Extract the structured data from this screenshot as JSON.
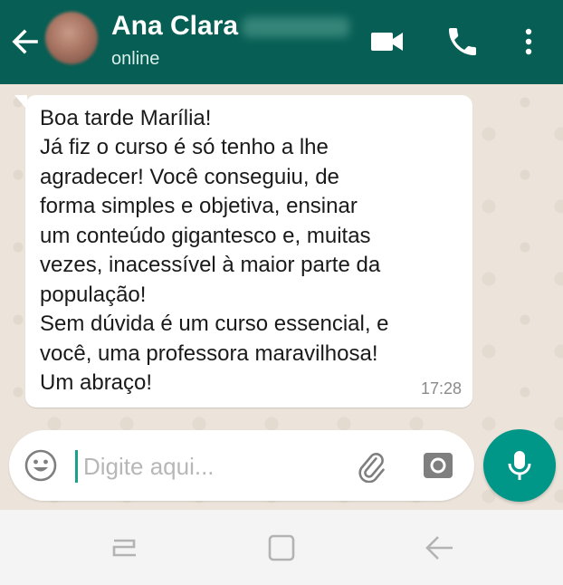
{
  "header": {
    "contact_name": "Ana Clara",
    "status": "online",
    "icons": [
      "back-arrow-icon",
      "video-call-icon",
      "phone-icon",
      "more-vertical-icon"
    ],
    "color": "#075e54"
  },
  "message": {
    "lines": [
      "Boa tarde Marília!",
      "Já fiz o curso é só tenho a lhe",
      "agradecer! Você conseguiu, de",
      "forma simples e objetiva, ensinar",
      "um conteúdo gigantesco e, muitas",
      "vezes, inacessível à maior parte da",
      "população!",
      "Sem dúvida é um curso essencial, e",
      "você, uma professora maravilhosa!",
      "Um abraço!"
    ],
    "time": "17:28"
  },
  "composer": {
    "placeholder": "Digite aqui...",
    "value": "",
    "icons": [
      "emoji-icon",
      "attach-icon",
      "camera-icon",
      "mic-icon"
    ],
    "accent": "#009688"
  },
  "nav": {
    "icons": [
      "recents-icon",
      "home-icon",
      "back-icon"
    ]
  }
}
